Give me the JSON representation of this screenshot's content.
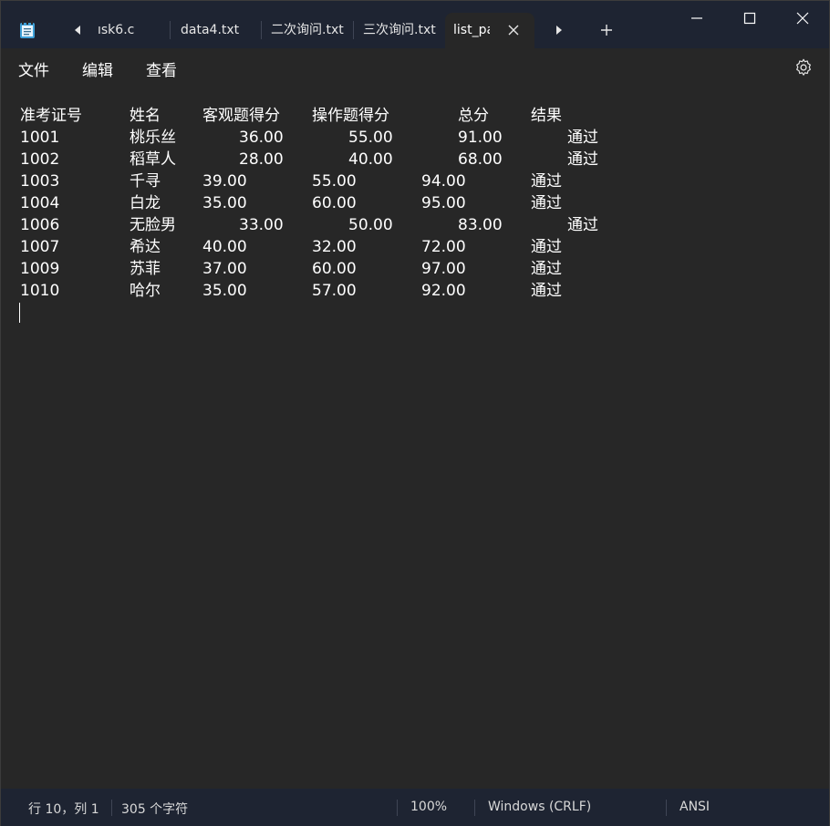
{
  "tabs": [
    {
      "label": "ısk6.c"
    },
    {
      "label": "data4.txt"
    },
    {
      "label": "二次询问.txt"
    },
    {
      "label": "三次询问.txt"
    },
    {
      "label": "list_pa"
    }
  ],
  "menu": {
    "file": "文件",
    "edit": "编辑",
    "view": "查看"
  },
  "document": {
    "header": [
      "准考证号",
      "姓名",
      "客观题得分",
      "操作题得分",
      "总分",
      "结果"
    ],
    "rows": [
      [
        "1001",
        "桃乐丝",
        "36.00",
        "55.00",
        "91.00",
        "通过"
      ],
      [
        "1002",
        "稻草人",
        "28.00",
        "40.00",
        "68.00",
        "通过"
      ],
      [
        "1003",
        "千寻",
        "39.00",
        "55.00",
        "94.00",
        "通过"
      ],
      [
        "1004",
        "白龙",
        "35.00",
        "60.00",
        "95.00",
        "通过"
      ],
      [
        "1006",
        "无脸男",
        "33.00",
        "50.00",
        "83.00",
        "通过"
      ],
      [
        "1007",
        "希达",
        "40.00",
        "32.00",
        "72.00",
        "通过"
      ],
      [
        "1009",
        "苏菲",
        "37.00",
        "60.00",
        "97.00",
        "通过"
      ],
      [
        "1010",
        "哈尔",
        "35.00",
        "57.00",
        "92.00",
        "通过"
      ]
    ]
  },
  "status": {
    "position": "行 10，列 1",
    "char_count": "305 个字符",
    "zoom": "100%",
    "line_ending": "Windows (CRLF)",
    "encoding": "ANSI"
  },
  "icons": {
    "app": "notepad-icon",
    "settings": "gear-icon"
  }
}
